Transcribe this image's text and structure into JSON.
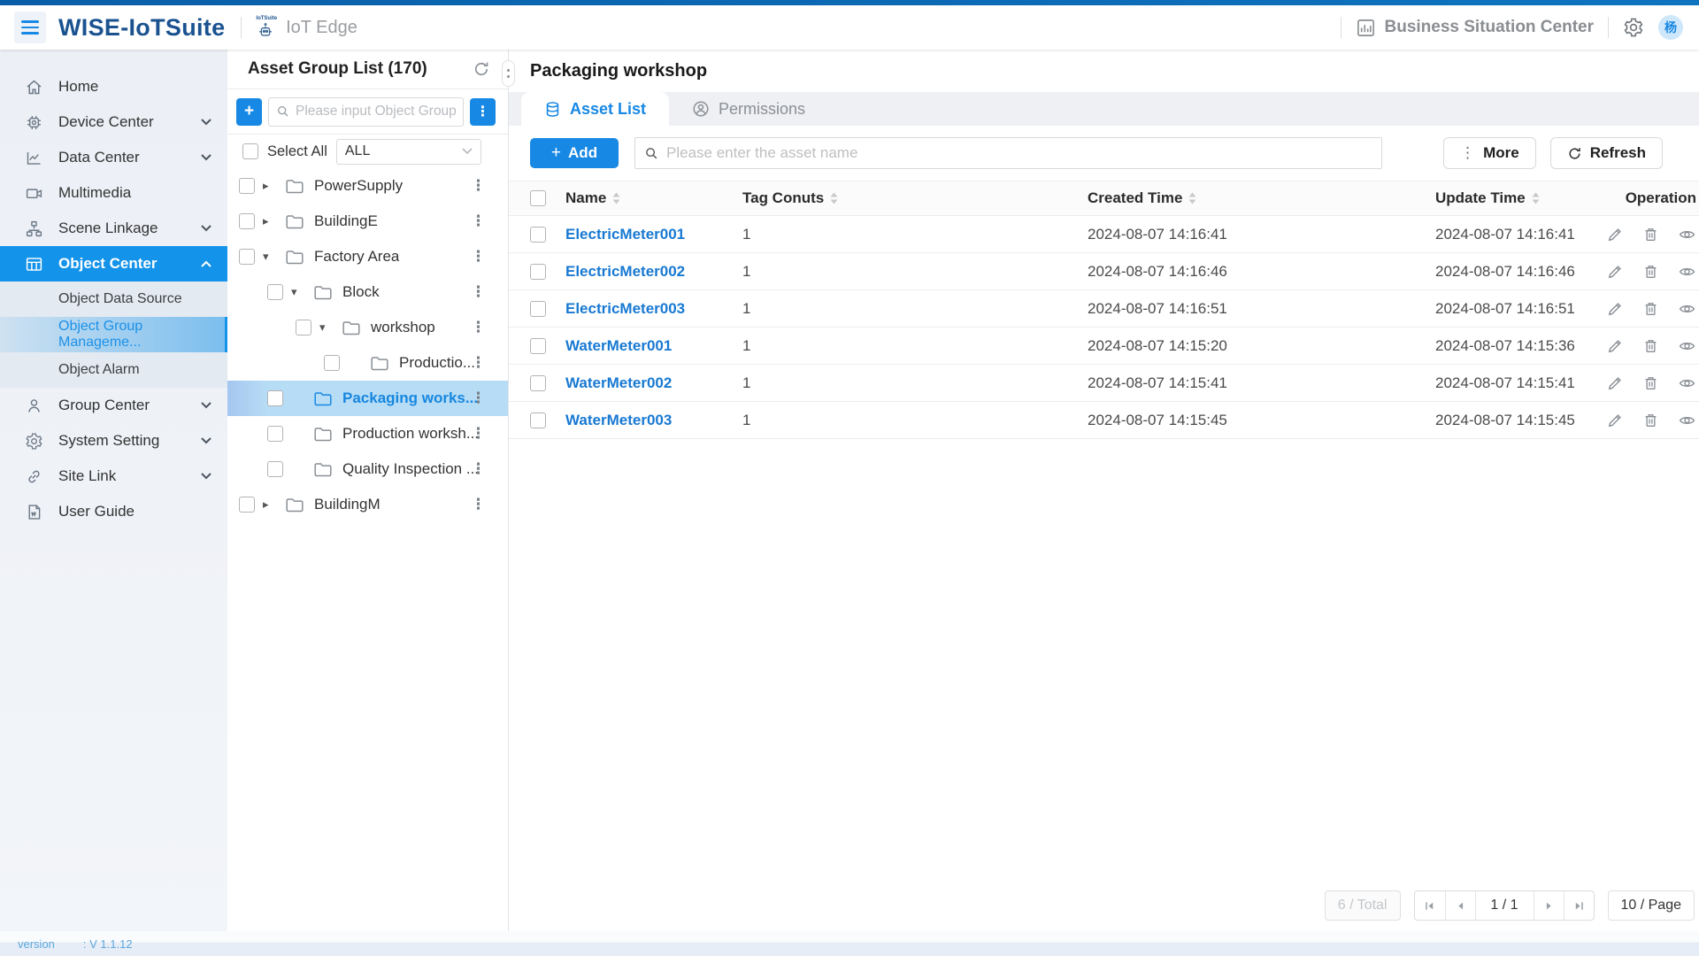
{
  "header": {
    "product": "WISE-IoTSuite",
    "edge_logo_text": "IoTSuite",
    "app": "IoT Edge",
    "portal": "Business Situation Center",
    "avatar": "杨"
  },
  "sidebar": {
    "items": [
      {
        "label": "Home"
      },
      {
        "label": "Device Center"
      },
      {
        "label": "Data Center"
      },
      {
        "label": "Multimedia"
      },
      {
        "label": "Scene Linkage"
      },
      {
        "label": "Object Center"
      },
      {
        "label": "Group Center"
      },
      {
        "label": "System Setting"
      },
      {
        "label": "Site Link"
      },
      {
        "label": "User Guide"
      }
    ],
    "submenu": [
      "Object Data Source",
      "Object Group Manageme...",
      "Object Alarm"
    ],
    "version_label": "version",
    "version_value": ": V 1.1.12"
  },
  "group_panel": {
    "title": "Asset Group List (170)",
    "search_placeholder": "Please input Object Group...",
    "select_all": "Select All",
    "filter": "ALL",
    "tree": [
      {
        "label": "PowerSupply",
        "level": 0,
        "expander": "collapsed",
        "selected": false
      },
      {
        "label": "BuildingE",
        "level": 0,
        "expander": "collapsed",
        "selected": false
      },
      {
        "label": "Factory Area",
        "level": 0,
        "expander": "expanded",
        "selected": false
      },
      {
        "label": "Block",
        "level": 1,
        "expander": "expanded",
        "selected": false
      },
      {
        "label": "workshop",
        "level": 2,
        "expander": "expanded",
        "selected": false
      },
      {
        "label": "Productio...",
        "level": 3,
        "expander": "none",
        "selected": false
      },
      {
        "label": "Packaging works...",
        "level": 1,
        "expander": "none",
        "selected": true
      },
      {
        "label": "Production worksh...",
        "level": 1,
        "expander": "none",
        "selected": false
      },
      {
        "label": "Quality Inspection ...",
        "level": 1,
        "expander": "none",
        "selected": false
      },
      {
        "label": "BuildingM",
        "level": 0,
        "expander": "collapsed",
        "selected": false
      }
    ]
  },
  "main": {
    "title": "Packaging workshop",
    "tabs": [
      {
        "label": "Asset List",
        "active": true
      },
      {
        "label": "Permissions",
        "active": false
      }
    ],
    "toolbar": {
      "add": "Add",
      "search_placeholder": "Please enter the asset name",
      "more": "More",
      "refresh": "Refresh"
    },
    "table": {
      "columns": [
        "Name",
        "Tag Conuts",
        "Created Time",
        "Update Time",
        "Operation"
      ],
      "rows": [
        {
          "name": "ElectricMeter001",
          "tags": "1",
          "created": "2024-08-07 14:16:41",
          "updated": "2024-08-07 14:16:41"
        },
        {
          "name": "ElectricMeter002",
          "tags": "1",
          "created": "2024-08-07 14:16:46",
          "updated": "2024-08-07 14:16:46"
        },
        {
          "name": "ElectricMeter003",
          "tags": "1",
          "created": "2024-08-07 14:16:51",
          "updated": "2024-08-07 14:16:51"
        },
        {
          "name": "WaterMeter001",
          "tags": "1",
          "created": "2024-08-07 14:15:20",
          "updated": "2024-08-07 14:15:36"
        },
        {
          "name": "WaterMeter002",
          "tags": "1",
          "created": "2024-08-07 14:15:41",
          "updated": "2024-08-07 14:15:41"
        },
        {
          "name": "WaterMeter003",
          "tags": "1",
          "created": "2024-08-07 14:15:45",
          "updated": "2024-08-07 14:15:45"
        }
      ]
    },
    "pagination": {
      "total": "6 / Total",
      "page": "1 / 1",
      "page_size": "10 / Page"
    }
  },
  "colors": {
    "primary": "#1788e4",
    "sidebar_active": "#1493ea",
    "link": "#1879d2"
  }
}
